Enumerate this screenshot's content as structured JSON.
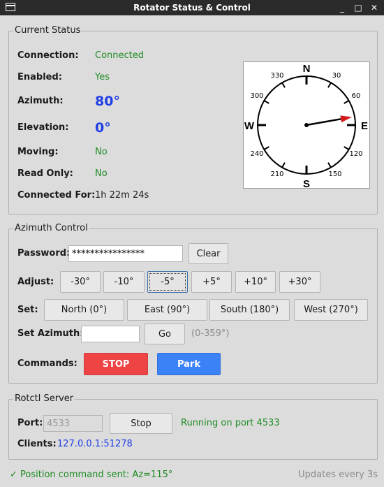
{
  "window": {
    "title": "Rotator Status & Control",
    "minimize": "_",
    "maximize": "□",
    "close": "✕"
  },
  "status_frame": {
    "title": "Current Status",
    "connection": {
      "label": "Connection:",
      "value": "Connected"
    },
    "enabled": {
      "label": "Enabled:",
      "value": "Yes"
    },
    "azimuth": {
      "label": "Azimuth:",
      "value": "80°",
      "degrees": 80
    },
    "elevation": {
      "label": "Elevation:",
      "value": "0°"
    },
    "moving": {
      "label": "Moving:",
      "value": "No"
    },
    "read_only": {
      "label": "Read Only:",
      "value": "No"
    },
    "connected_for": {
      "label": "Connected For:",
      "value": "1h 22m 24s"
    },
    "compass": {
      "cardinals": {
        "n": "N",
        "e": "E",
        "s": "S",
        "w": "W"
      },
      "degree_labels": {
        "d30": "30",
        "d60": "60",
        "d120": "120",
        "d150": "150",
        "d210": "210",
        "d240": "240",
        "d300": "300",
        "d330": "330"
      }
    }
  },
  "azimuth_frame": {
    "title": "Azimuth Control",
    "password": {
      "label": "Password:",
      "value": "****************",
      "clear": "Clear"
    },
    "adjust": {
      "label": "Adjust:",
      "buttons": [
        "-30°",
        "-10°",
        "-5°",
        "+5°",
        "+10°",
        "+30°"
      ]
    },
    "set": {
      "label": "Set:",
      "buttons": [
        "North (0°)",
        "East (90°)",
        "South (180°)",
        "West (270°)"
      ]
    },
    "set_azimuth": {
      "label": "Set Azimuth:",
      "value": "",
      "go": "Go",
      "hint": "(0-359°)"
    },
    "commands": {
      "label": "Commands:",
      "stop": "STOP",
      "park": "Park"
    }
  },
  "server_frame": {
    "title": "Rotctl Server",
    "port": {
      "label": "Port:",
      "value": "4533",
      "stop": "Stop",
      "status": "Running on port 4533"
    },
    "clients": {
      "label": "Clients:",
      "value": "127.0.0.1:51278"
    }
  },
  "status_bar": {
    "message": "✓ Position command sent: Az=115°",
    "updates": "Updates every 3s"
  },
  "colors": {
    "green": "#1f8b24",
    "blue": "#1f3ee6",
    "stop_red": "#ee4444",
    "park_blue": "#3b82f6",
    "needle_red": "#d11a1a"
  }
}
